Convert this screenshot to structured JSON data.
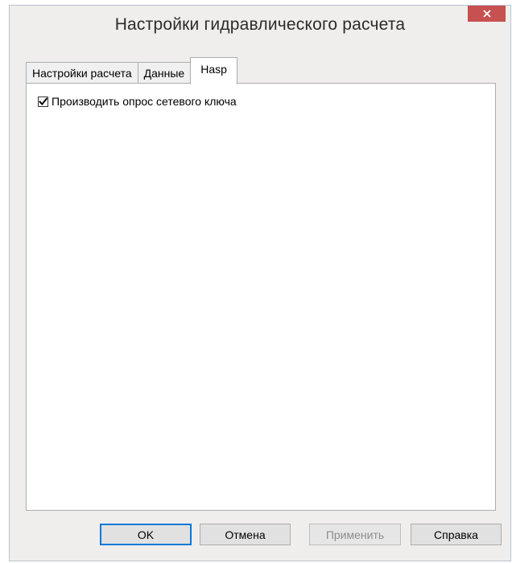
{
  "window": {
    "title": "Настройки гидравлического расчета",
    "close_icon": "close-icon"
  },
  "tabs": [
    {
      "label": "Настройки расчета",
      "active": false
    },
    {
      "label": "Данные",
      "active": false
    },
    {
      "label": "Hasp",
      "active": true
    }
  ],
  "hasp_panel": {
    "network_key_checkbox": {
      "label": "Производить опрос сетевого ключа",
      "checked": true
    }
  },
  "buttons": {
    "ok": "OK",
    "cancel": "Отмена",
    "apply": "Применить",
    "help": "Справка"
  },
  "colors": {
    "close_button": "#c75050",
    "default_button_border": "#0078d7",
    "dialog_background": "#efeeec"
  }
}
